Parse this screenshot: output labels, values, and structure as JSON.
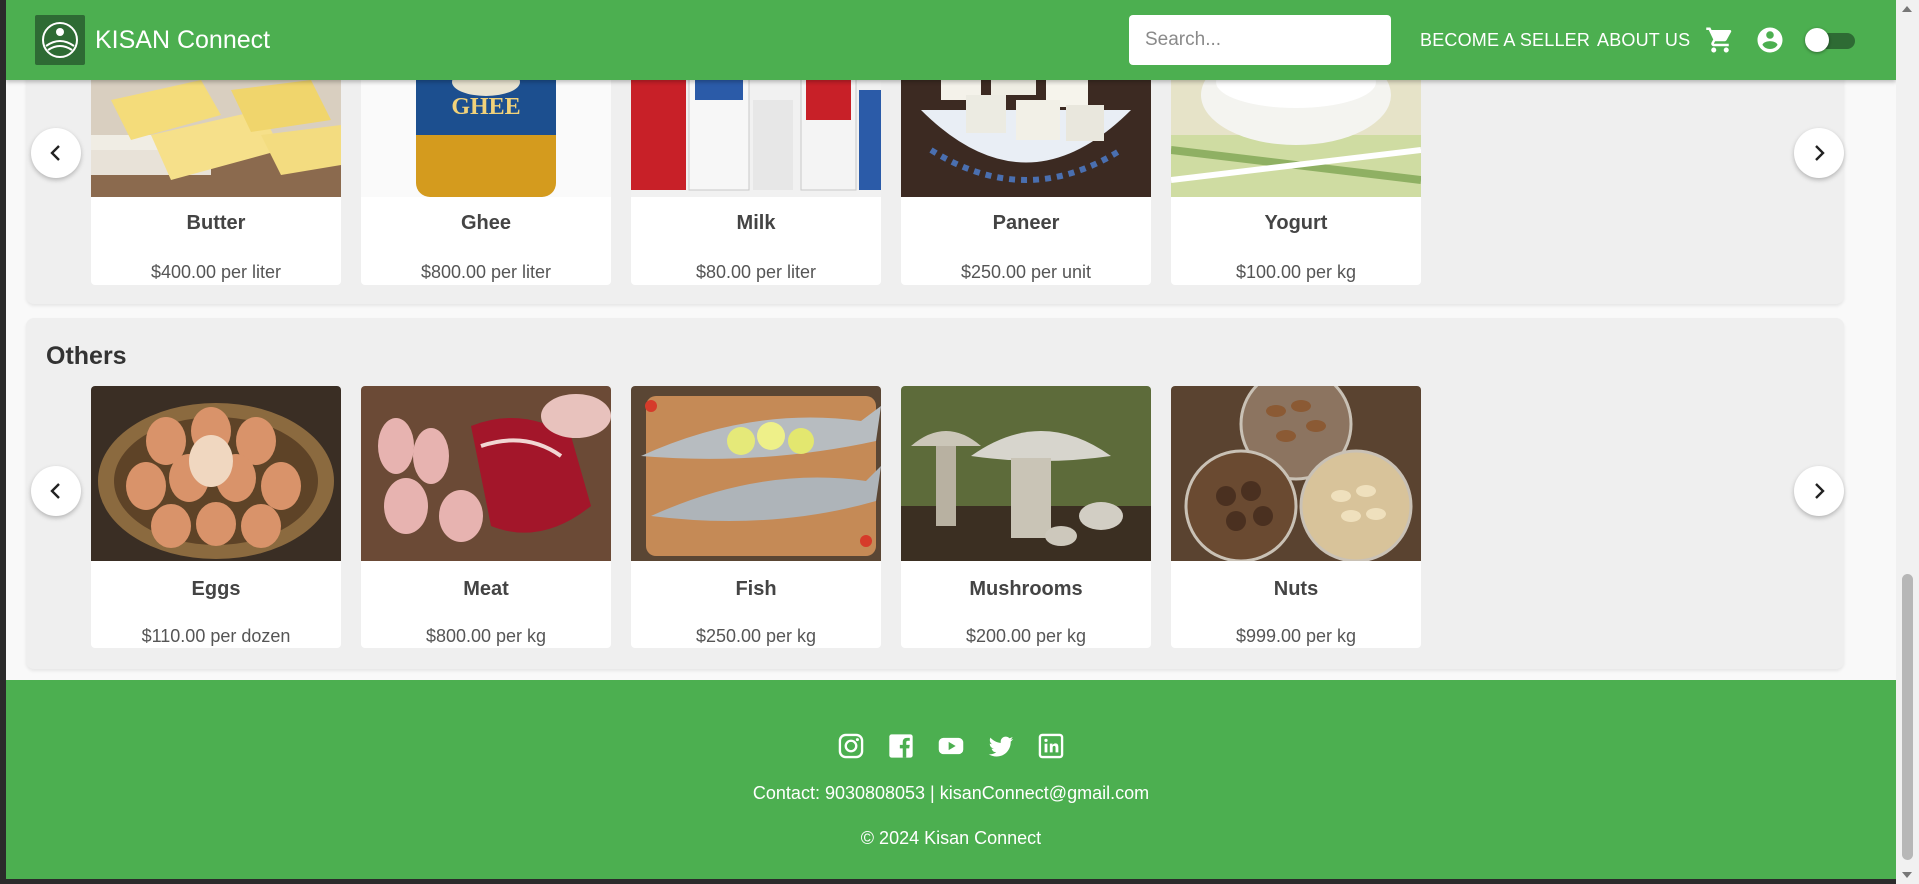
{
  "header": {
    "brand": "KISAN Connect",
    "search_placeholder": "Search...",
    "nav_seller": "BECOME A SELLER",
    "nav_about": "ABOUT US"
  },
  "dairy": {
    "products": [
      {
        "name": "Butter",
        "price": "$400.00 per liter"
      },
      {
        "name": "Ghee",
        "price": "$800.00 per liter"
      },
      {
        "name": "Milk",
        "price": "$80.00 per liter"
      },
      {
        "name": "Paneer",
        "price": "$250.00 per unit"
      },
      {
        "name": "Yogurt",
        "price": "$100.00 per kg"
      }
    ]
  },
  "others": {
    "title": "Others",
    "products": [
      {
        "name": "Eggs",
        "price": "$110.00 per dozen"
      },
      {
        "name": "Meat",
        "price": "$800.00 per kg"
      },
      {
        "name": "Fish",
        "price": "$250.00 per kg"
      },
      {
        "name": "Mushrooms",
        "price": "$200.00 per kg"
      },
      {
        "name": "Nuts",
        "price": "$999.00 per kg"
      }
    ]
  },
  "footer": {
    "social_icons": [
      "instagram-icon",
      "facebook-icon",
      "youtube-icon",
      "twitter-icon",
      "linkedin-icon"
    ],
    "contact": "Contact: 9030808053 | kisanConnect@gmail.com",
    "copyright": "© 2024 Kisan Connect"
  },
  "colors": {
    "brand_green": "#4caf50",
    "dark_green": "#2e6b34"
  }
}
